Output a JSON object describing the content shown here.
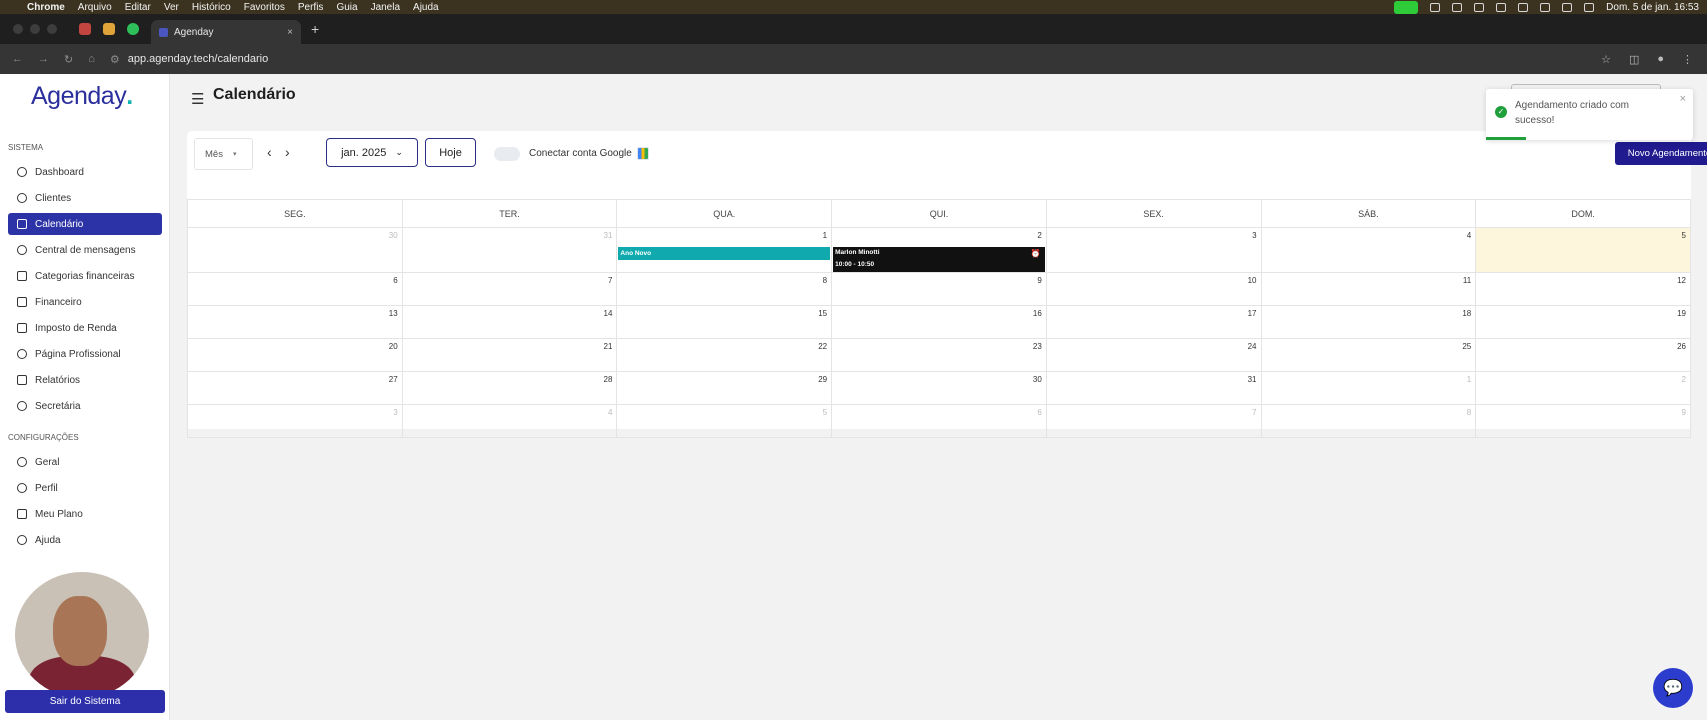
{
  "mac": {
    "apple": "",
    "menus": [
      "Chrome",
      "Arquivo",
      "Editar",
      "Ver",
      "Histórico",
      "Favoritos",
      "Perfis",
      "Guia",
      "Janela",
      "Ajuda"
    ],
    "datetime": "Dom. 5 de jan.  16:53"
  },
  "browser": {
    "tab_title": "Agenday",
    "tab_close": "×",
    "new_tab": "+",
    "url": "app.agenday.tech/calendario"
  },
  "sidebar": {
    "logo": "Agenday",
    "logo_dot": ".",
    "section_system": "SISTEMA",
    "section_config": "CONFIGURAÇÕES",
    "system_items": [
      "Dashboard",
      "Clientes",
      "Calendário",
      "Central de mensagens",
      "Categorias financeiras",
      "Financeiro",
      "Imposto de Renda",
      "Página Profissional",
      "Relatórios",
      "Secretária"
    ],
    "config_items": [
      "Geral",
      "Perfil",
      "Meu Plano",
      "Ajuda"
    ],
    "logout": "Sair do Sistema"
  },
  "header": {
    "title": "Calendário",
    "menu_icon": "☰"
  },
  "toolbar": {
    "view": "Mês",
    "prev": "‹",
    "next": "›",
    "month": "jan. 2025",
    "today": "Hoje",
    "google": "Conectar conta Google",
    "new_appointment": "Novo Agendamento"
  },
  "toast": {
    "message": "Agendamento criado com sucesso!",
    "close": "×"
  },
  "calendar": {
    "weekdays": [
      "SEG.",
      "TER.",
      "QUA.",
      "QUI.",
      "SEX.",
      "SÁB.",
      "DOM."
    ],
    "weeks": [
      [
        "30",
        "31",
        "1",
        "2",
        "3",
        "4",
        "5"
      ],
      [
        "6",
        "7",
        "8",
        "9",
        "10",
        "11",
        "12"
      ],
      [
        "13",
        "14",
        "15",
        "16",
        "17",
        "18",
        "19"
      ],
      [
        "20",
        "21",
        "22",
        "23",
        "24",
        "25",
        "26"
      ],
      [
        "27",
        "28",
        "29",
        "30",
        "31",
        "1",
        "2"
      ],
      [
        "3",
        "4",
        "5",
        "6",
        "7",
        "8",
        "9"
      ]
    ],
    "events": {
      "holiday": "Ano Novo",
      "appt_name": "Marlon Minotti",
      "appt_time": "10:00 - 10:50"
    }
  }
}
